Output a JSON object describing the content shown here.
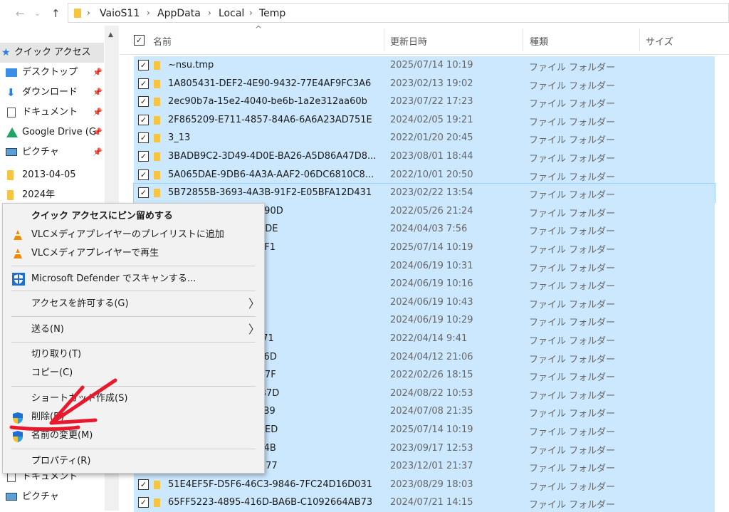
{
  "address": {
    "crumbs": [
      "VaioS11",
      "AppData",
      "Local",
      "Temp"
    ],
    "back": "←",
    "forward": "→",
    "recent": "⌄",
    "up": "↑"
  },
  "sidebar": {
    "items": [
      {
        "label": "クイック アクセス",
        "icon": "star-icon"
      },
      {
        "label": "デスクトップ",
        "icon": "desktop-icon"
      },
      {
        "label": "ダウンロード",
        "icon": "download-icon"
      },
      {
        "label": "ドキュメント",
        "icon": "document-icon"
      },
      {
        "label": "Google Drive (G",
        "icon": "google-drive-icon"
      },
      {
        "label": "ピクチャ",
        "icon": "pictures-icon"
      },
      {
        "label": "2013-04-05",
        "icon": "folder-icon"
      },
      {
        "label": "2024年",
        "icon": "folder-icon"
      }
    ],
    "bottom_items": [
      {
        "label": "ドキュメント",
        "icon": "document-icon"
      },
      {
        "label": "ピクチャ",
        "icon": "pictures-icon"
      }
    ],
    "pin": "📌"
  },
  "columns": {
    "name": "名前",
    "date": "更新日時",
    "type": "種類",
    "size": "サイズ",
    "sort_indicator": "^"
  },
  "rows": [
    {
      "name": "~nsu.tmp",
      "date": "2025/07/14 10:19",
      "type": "ファイル フォルダー"
    },
    {
      "name": "1A805431-DEF2-4E90-9432-77E4AF9FC3A6",
      "date": "2023/02/13 19:02",
      "type": "ファイル フォルダー"
    },
    {
      "name": "2ec90b7a-15e2-4040-be6b-1a2e312aa60b",
      "date": "2023/07/22 17:23",
      "type": "ファイル フォルダー"
    },
    {
      "name": "2F865209-E711-4857-84A6-6A6A23AD751E",
      "date": "2024/02/05 19:21",
      "type": "ファイル フォルダー"
    },
    {
      "name": "3_13",
      "date": "2022/01/20 20:45",
      "type": "ファイル フォルダー"
    },
    {
      "name": "3BADB9C2-3D49-4D0E-BA26-A5D86A47D8...",
      "date": "2023/08/01 18:44",
      "type": "ファイル フォルダー"
    },
    {
      "name": "5A065DAE-9DB6-4A3A-AAF2-06DC6810C8...",
      "date": "2022/10/01 20:50",
      "type": "ファイル フォルダー"
    },
    {
      "name": "5B72855B-3693-4A3B-91F2-E05BFA12D431",
      "date": "2023/02/22 13:54",
      "type": "ファイル フォルダー"
    },
    {
      "name": "B5-BF42-C76E801DF90D",
      "date": "2022/05/26 21:24",
      "type": "ファイル フォルダー"
    },
    {
      "name": "C-9CA9-0628EFCA11DE",
      "date": "2024/04/03 7:56",
      "type": "ファイル フォルダー"
    },
    {
      "name": "A-86AD-1FEE613158F1",
      "date": "2025/07/14 10:19",
      "type": "ファイル フォルダー"
    },
    {
      "name": "",
      "date": "2024/06/19 10:31",
      "type": "ファイル フォルダー"
    },
    {
      "name": "",
      "date": "2024/06/19 10:16",
      "type": "ファイル フォルダー"
    },
    {
      "name": "",
      "date": "2024/06/19 10:43",
      "type": "ファイル フォルダー"
    },
    {
      "name": "",
      "date": "2024/06/19 10:29",
      "type": "ファイル フォルダー"
    },
    {
      "name": "B-AF43-9FA963950671",
      "date": "2022/04/14 9:41",
      "type": "ファイル フォルダー"
    },
    {
      "name": "E-8E1B-19E182835A6D",
      "date": "2024/04/12 21:06",
      "type": "ファイル フォルダー"
    },
    {
      "name": "0-932E-D0611709C07F",
      "date": "2022/02/26 18:15",
      "type": "ファイル フォルダー"
    },
    {
      "name": "7-A8B4-3A7AA29A0B7D",
      "date": "2024/08/22 10:53",
      "type": "ファイル フォルダー"
    },
    {
      "name": "E-A332-F2086B6E81B9",
      "date": "2024/07/08 21:35",
      "type": "ファイル フォルダー"
    },
    {
      "name": "9-BC32-A87349B1C0ED",
      "date": "2025/07/14 10:19",
      "type": "ファイル フォルダー"
    },
    {
      "name": "3-AAF3-F8600B670C4B",
      "date": "2023/09/17 12:53",
      "type": "ファイル フォルダー"
    },
    {
      "name": "3-87B5-CE14AD4E3377",
      "date": "2023/12/01 21:37",
      "type": "ファイル フォルダー"
    },
    {
      "name": "51E4EF5F-D5F6-46C3-9846-7FC24D16D031",
      "date": "2023/08/29 18:03",
      "type": "ファイル フォルダー"
    },
    {
      "name": "65FF5223-4895-416D-BA6B-C1092664AB73",
      "date": "2024/07/21 14:15",
      "type": "ファイル フォルダー"
    }
  ],
  "context_menu": {
    "pin": "クイック アクセスにピン留めする",
    "vlc_playlist": "VLCメディアプレイヤーのプレイリストに追加",
    "vlc_play": "VLCメディアプレイヤーで再生",
    "defender": "Microsoft Defender でスキャンする...",
    "access": "アクセスを許可する(G)",
    "send": "送る(N)",
    "cut": "切り取り(T)",
    "copy": "コピー(C)",
    "shortcut": "ショートカット作成(S)",
    "delete": "削除(D)",
    "rename": "名前の変更(M)",
    "properties": "プロパティ(R)",
    "submenu_arrow": "〉"
  },
  "colors": {
    "selection": "#cce8ff",
    "annotation_red": "#e8192c",
    "folder": "#f5c542"
  },
  "check": "✓"
}
